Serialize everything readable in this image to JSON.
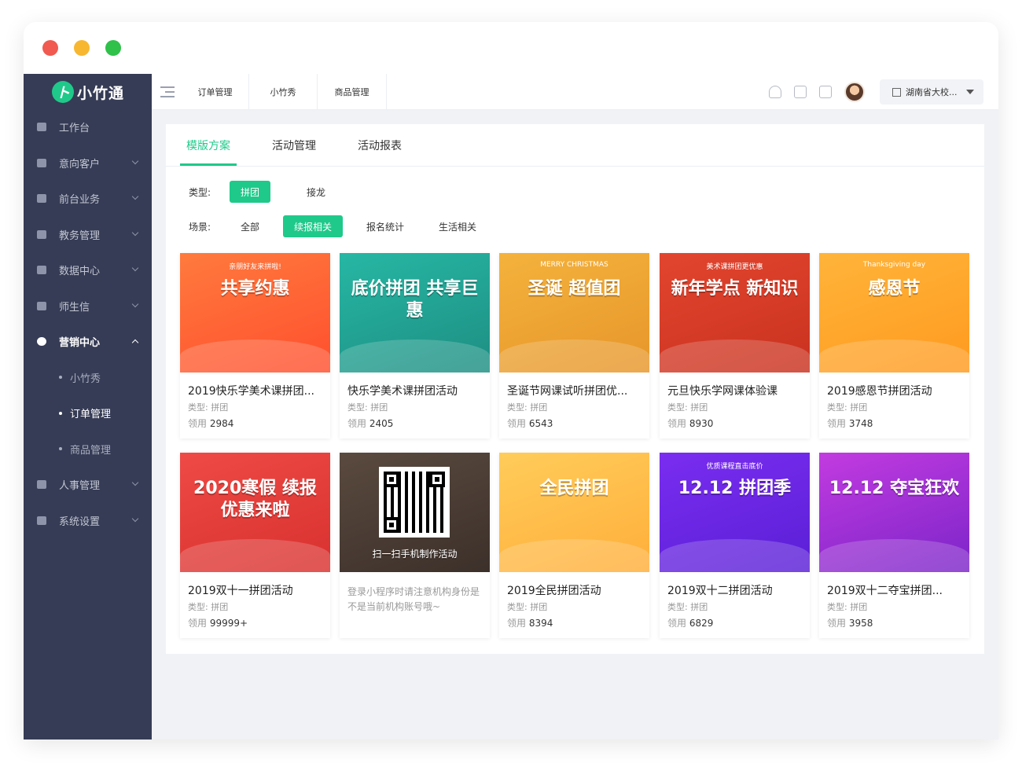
{
  "app": {
    "logo_text": "小竹通",
    "logo_glyph": "ト"
  },
  "sidebar": {
    "items": [
      {
        "label": "工作台",
        "icon": "monitor-icon",
        "expandable": false
      },
      {
        "label": "意向客户",
        "icon": "user-icon",
        "expandable": true
      },
      {
        "label": "前台业务",
        "icon": "desk-icon",
        "expandable": true
      },
      {
        "label": "教务管理",
        "icon": "book-icon",
        "expandable": true
      },
      {
        "label": "数据中心",
        "icon": "chart-icon",
        "expandable": true
      },
      {
        "label": "师生信",
        "icon": "message-icon",
        "expandable": true
      },
      {
        "label": "营销中心",
        "icon": "pie-icon",
        "expandable": true,
        "open": true
      },
      {
        "label": "人事管理",
        "icon": "staff-icon",
        "expandable": true
      },
      {
        "label": "系统设置",
        "icon": "settings-icon",
        "expandable": true
      }
    ],
    "sub_items": [
      {
        "label": "小竹秀",
        "selected": false
      },
      {
        "label": "订单管理",
        "selected": true
      },
      {
        "label": "商品管理",
        "selected": false
      }
    ]
  },
  "topbar": {
    "tabs": [
      "订单管理",
      "小竹秀",
      "商品管理"
    ],
    "icons": [
      "bell-icon",
      "chat-icon",
      "help-icon"
    ],
    "org_name": "湖南省大校..."
  },
  "panel": {
    "tabs": [
      {
        "label": "模版方案",
        "active": true
      },
      {
        "label": "活动管理",
        "active": false
      },
      {
        "label": "活动报表",
        "active": false
      }
    ],
    "type_filter": {
      "label": "类型:",
      "options": [
        {
          "label": "拼团",
          "on": true
        },
        {
          "label": "接龙",
          "on": false
        }
      ]
    },
    "scene_filter": {
      "label": "场景:",
      "options": [
        {
          "label": "全部",
          "on": false
        },
        {
          "label": "续报相关",
          "on": true
        },
        {
          "label": "报名统计",
          "on": false
        },
        {
          "label": "生活相关",
          "on": false
        }
      ]
    }
  },
  "cards": [
    {
      "title": "2019快乐学美术课拼团...",
      "type": "类型:  拼团",
      "count_label": "领用",
      "count": "2984",
      "art": "共享约惠",
      "art_sub": "亲朋好友来拼啦!",
      "bg": [
        "#ff7a3d",
        "#ff4f2e"
      ]
    },
    {
      "title": "快乐学美术课拼团活动",
      "type": "类型:  拼团",
      "count_label": "领用",
      "count": "2405",
      "art": "底价拼团 共享巨惠",
      "art_sub": "",
      "bg": [
        "#27b7a4",
        "#1d8e82"
      ]
    },
    {
      "title": "圣诞节网课试听拼团优...",
      "type": "类型:  拼团",
      "count_label": "领用",
      "count": "6543",
      "art": "圣诞 超值团",
      "art_sub": "MERRY CHRISTMAS",
      "bg": [
        "#f4b23c",
        "#e7962a"
      ]
    },
    {
      "title": "元旦快乐学网课体验课",
      "type": "类型:  拼团",
      "count_label": "领用",
      "count": "8930",
      "art": "新年学点 新知识",
      "art_sub": "美术课拼团更优惠",
      "bg": [
        "#e2452f",
        "#c9321f"
      ]
    },
    {
      "title": "2019感恩节拼团活动",
      "type": "类型:  拼团",
      "count_label": "领用",
      "count": "3748",
      "art": "感恩节",
      "art_sub": "Thanksgiving day",
      "bg": [
        "#ffb43a",
        "#ff9a1f"
      ]
    },
    {
      "title": "2019双十一拼团活动",
      "type": "类型:  拼团",
      "count_label": "领用",
      "count": "99999+",
      "art": "2020寒假 续报优惠来啦",
      "art_sub": "",
      "bg": [
        "#ef4a45",
        "#d8312f"
      ]
    },
    {
      "title": "",
      "type": "",
      "count_label": "",
      "count": "",
      "note": "登录小程序时请注意机构身份是不是当前机构账号哦~",
      "art": "扫一扫手机制作活动",
      "art_sub": "",
      "bg": [
        "#5a4a3f",
        "#3c302a"
      ],
      "qr": true
    },
    {
      "title": "2019全民拼团活动",
      "type": "类型:  拼团",
      "count_label": "领用",
      "count": "8394",
      "art": "全民拼团",
      "art_sub": "",
      "bg": [
        "#ffcc5a",
        "#ffae3a"
      ]
    },
    {
      "title": "2019双十二拼团活动",
      "type": "类型:  拼团",
      "count_label": "领用",
      "count": "6829",
      "art": "12.12 拼团季",
      "art_sub": "优质课程直击底价",
      "bg": [
        "#7a2df0",
        "#5a1fd6"
      ]
    },
    {
      "title": "2019双十二夺宝拼团...",
      "type": "类型:  拼团",
      "count_label": "领用",
      "count": "3958",
      "art": "12.12 夺宝狂欢",
      "art_sub": "",
      "bg": [
        "#c23be0",
        "#7b25c9"
      ]
    }
  ],
  "colors": {
    "accent": "#1fc98a",
    "sidebar_bg": "#363c55",
    "content_bg": "#f1f2f5"
  }
}
